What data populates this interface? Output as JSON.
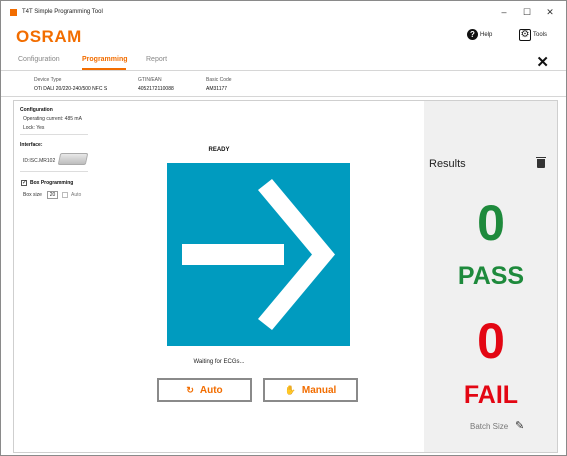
{
  "window": {
    "title": "T4T Simple Programming Tool",
    "minimize_glyph": "–",
    "maximize_glyph": "☐",
    "close_glyph": "✕"
  },
  "header": {
    "logo": "OSRAM",
    "help_label": "Help",
    "tools_label": "Tools",
    "help_glyph": "?",
    "tools_glyph": "⚙",
    "close_glyph": "✕"
  },
  "tabs": [
    {
      "label": "Configuration"
    },
    {
      "label": "Programming"
    },
    {
      "label": "Report"
    }
  ],
  "device": {
    "type_key": "Device Type",
    "type_value": "OTi DALI 20/220-240/500 NFC S",
    "gtin_key": "GTIN/EAN",
    "gtin_value": "4052172110088",
    "code_key": "Basic Code",
    "code_value": "AM31177"
  },
  "configuration": {
    "title": "Configuration",
    "current": "Operating current: 485 mA",
    "lock": "Lock: Yes"
  },
  "interface": {
    "title": "Interface:",
    "id": "ID:ISC.MR102"
  },
  "box_programming": {
    "label": "Box Programming",
    "checked_glyph": "✓",
    "box_size_label": "Box size",
    "box_size_value": "20",
    "auto_label": "Auto"
  },
  "status": {
    "ready": "READY",
    "waiting": "Waiting for ECGs..."
  },
  "buttons": {
    "auto_label": "Auto",
    "manual_label": "Manual",
    "auto_glyph": "↻",
    "manual_glyph": "✋"
  },
  "results": {
    "title": "Results",
    "pass_count": "0",
    "pass_label": "PASS",
    "fail_count": "0",
    "fail_label": "FAIL",
    "batch_label": "Batch Size",
    "edit_glyph": "✎"
  },
  "colors": {
    "accent": "#f26d00",
    "arrow_bg": "#009bbf",
    "pass": "#1e8a3c",
    "fail": "#e30613"
  },
  "icons": [
    "app-icon",
    "help-icon",
    "tools-icon",
    "close-icon",
    "interface-device-icon",
    "arrow-right-icon",
    "refresh-icon",
    "hand-icon",
    "trash-icon",
    "pencil-icon"
  ]
}
